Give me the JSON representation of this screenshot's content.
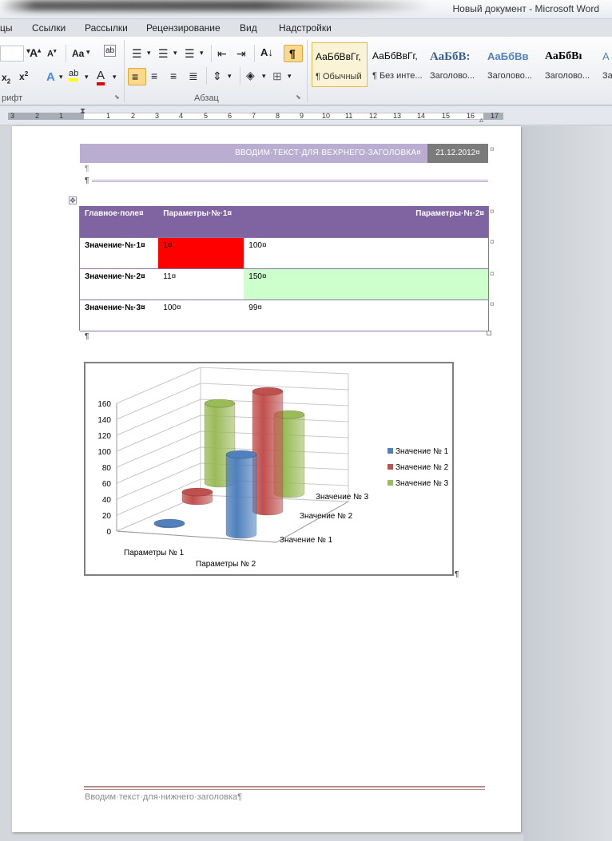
{
  "window": {
    "title": "Новый документ  -  Microsoft Word"
  },
  "tabs": [
    "цы",
    "Ссылки",
    "Рассылки",
    "Рецензирование",
    "Вид",
    "Надстройки"
  ],
  "ribbon": {
    "font_group_label": "рифт",
    "paragraph_group_label": "Абзац",
    "font_size_value": "",
    "aa_label": "Aa",
    "styles": [
      {
        "preview": "АаБбВвГг,",
        "name": "¶ Обычный"
      },
      {
        "preview": "АаБбВвГг,",
        "name": "¶ Без инте..."
      },
      {
        "preview": "АаБбВ:",
        "name": "Заголово..."
      },
      {
        "preview": "АаБбВв",
        "name": "Заголово..."
      },
      {
        "preview": "АаБбВı",
        "name": "Заголово..."
      },
      {
        "preview": "А",
        "name": "За"
      }
    ]
  },
  "ruler": {
    "ticks": [
      "3",
      "2",
      "1",
      "1",
      "2",
      "3",
      "4",
      "5",
      "6",
      "7",
      "8",
      "9",
      "10",
      "11",
      "12",
      "13",
      "14",
      "15",
      "16",
      "17"
    ]
  },
  "document": {
    "header_text": "ВВОДИМ·ТЕКСТ·ДЛЯ·ВЕХРНЕГО·ЗАГОЛОВКА¤",
    "header_date": "21.12.2012¤",
    "pilcrow": "¶",
    "cell_mark": "¤",
    "table": {
      "headers": [
        "Главное·поле¤",
        "Параметры·№·1¤",
        "Параметры·№·2¤"
      ],
      "rows": [
        [
          "Значение·№·1¤",
          "1¤",
          "100¤"
        ],
        [
          "Значение·№·2¤",
          "11¤",
          "150¤"
        ],
        [
          "Значение·№·3¤",
          "100¤",
          "99¤"
        ]
      ]
    },
    "footer_text": "Вводим·текст·для·нижнего·заголовка¶"
  },
  "colors": {
    "cell_red": "#ff0000",
    "cell_green": "#ccffcc",
    "header_purple": "#8064a2"
  },
  "chart_data": {
    "type": "bar",
    "style": "3d-cylinder",
    "categories": [
      "Параметры № 1",
      "Параметры № 2"
    ],
    "series": [
      {
        "name": "Значение № 1",
        "values": [
          1,
          100
        ],
        "color": "#4f81bd"
      },
      {
        "name": "Значение № 2",
        "values": [
          11,
          150
        ],
        "color": "#c0504d"
      },
      {
        "name": "Значение № 3",
        "values": [
          100,
          99
        ],
        "color": "#9bbb59"
      }
    ],
    "y_ticks": [
      "0",
      "20",
      "40",
      "60",
      "80",
      "100",
      "120",
      "140",
      "160"
    ],
    "ylim": [
      0,
      160
    ],
    "grid": true,
    "legend": "right"
  }
}
